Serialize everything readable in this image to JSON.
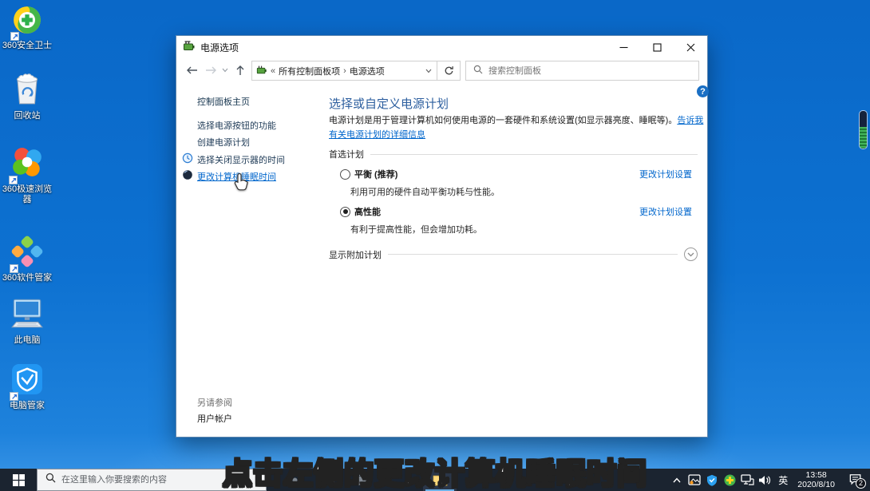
{
  "colors": {
    "link": "#0066cc",
    "heading": "#2d5f9f",
    "taskbar_bg": "#1b2430",
    "desktop_blue": "#0d71d1",
    "selection_blue": "#6cb2e8"
  },
  "desktop": {
    "icons": [
      {
        "label": "360安全卫士"
      },
      {
        "label": "回收站"
      },
      {
        "label": "360极速浏览器"
      },
      {
        "label": "360软件管家"
      },
      {
        "label": "此电脑"
      },
      {
        "label": "电脑管家"
      }
    ]
  },
  "window": {
    "title": "电源选项",
    "nav": {
      "breadcrumb_root": "所有控制面板项",
      "breadcrumb_current": "电源选项",
      "breadcrumb_arrows": "«",
      "breadcrumb_sep": "›",
      "search_placeholder": "搜索控制面板"
    },
    "sidebar": {
      "home": "控制面板主页",
      "items": [
        {
          "label": "选择电源按钮的功能"
        },
        {
          "label": "创建电源计划"
        },
        {
          "label": "选择关闭显示器的时间"
        },
        {
          "label": "更改计算机睡眠时间"
        }
      ],
      "see_also_title": "另请参阅",
      "see_also_link": "用户帐户"
    },
    "main": {
      "help": "?",
      "title": "选择或自定义电源计划",
      "description": "电源计划是用于管理计算机如何使用电源的一套硬件和系统设置(如显示器亮度、睡眠等)。",
      "description_link": "告诉我有关电源计划的详细信息",
      "section_preferred": "首选计划",
      "plans": [
        {
          "name": "平衡 (推荐)",
          "desc": "利用可用的硬件自动平衡功耗与性能。",
          "link": "更改计划设置",
          "selected": false
        },
        {
          "name": "高性能",
          "desc": "有利于提高性能，但会增加功耗。",
          "link": "更改计划设置",
          "selected": true
        }
      ],
      "section_additional": "显示附加计划"
    }
  },
  "taskbar": {
    "search_placeholder": "在这里输入你要搜索的内容",
    "tray": {
      "language": "英",
      "time": "13:58",
      "date": "2020/8/10",
      "notification_badge": "2"
    }
  },
  "caption": "点击左侧的更改计算机睡眠时间"
}
